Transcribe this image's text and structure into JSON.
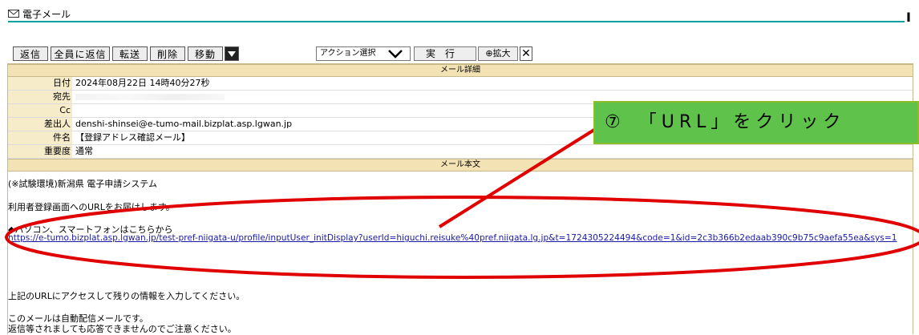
{
  "window": {
    "title": "電子メール",
    "corner_label": "I"
  },
  "toolbar": {
    "reply": "返信",
    "reply_all": "全員に返信",
    "forward": "転送",
    "delete": "削除",
    "move": "移動",
    "action_select": "アクション選択",
    "execute": "実行",
    "zoom": "⊕拡大",
    "close": "✕"
  },
  "details": {
    "header": "メール詳細",
    "date_label": "日付",
    "date_value": "2024年08月22日 14時40分27秒",
    "to_label": "宛先",
    "cc_label": "Cc",
    "from_label": "差出人",
    "from_value": "denshi-shinsei@e-tumo-mail.bizplat.asp.lgwan.jp",
    "subject_label": "件名",
    "subject_value": "【登録アドレス確認メール】",
    "priority_label": "重要度",
    "priority_value": "通常"
  },
  "body": {
    "header": "メール本文",
    "line1": "(※試験環境)新潟県 電子申請システム",
    "line2": "利用者登録画面へのURLをお届けします。",
    "line3": "◆パソコン、スマートフォンはこちらから",
    "link": "https://e-tumo.bizplat.asp.lgwan.jp/test-pref-niigata-u/profile/inputUser_initDisplay?userId=higuchi.reisuke%40pref.niigata.lg.jp&t=1724305224494&code=1&id=2c3b366b2edaab390c9b75c9aefa55ea&sys=1",
    "line4": "上記のURLにアクセスして残りの情報を入力してください。",
    "line5": "このメールは自動配信メールです。",
    "line6": "返信等されましても応答できませんのでご注意ください。"
  },
  "annotation": {
    "text": "⑦　「URL」をクリック"
  },
  "colors": {
    "callout_bg": "#5fc24a",
    "annotation_red": "#e00000",
    "section_bg": "#f3e3b4",
    "label_bg": "#f6ecca",
    "link": "#1a1aa8"
  }
}
